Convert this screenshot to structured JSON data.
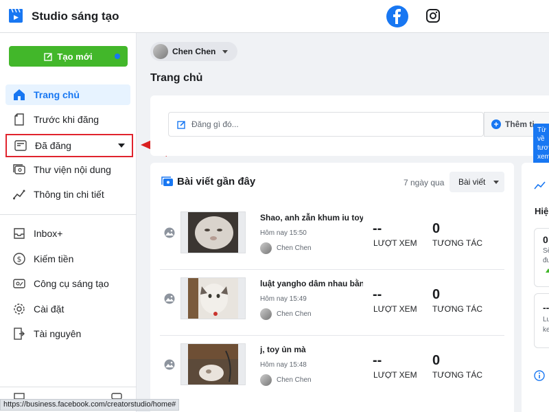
{
  "app": {
    "title": "Studio sáng tạo"
  },
  "header": {
    "facebook_icon": "facebook-icon",
    "instagram_icon": "instagram-icon"
  },
  "sidebar": {
    "create_label": "Tạo mới",
    "items": [
      {
        "label": "Trang chủ",
        "icon": "home-icon",
        "active": true
      },
      {
        "label": "Trước khi đăng",
        "icon": "draft-document-icon"
      },
      {
        "label": "Đã đăng",
        "icon": "published-posts-icon",
        "highlight": true
      },
      {
        "label": "Thư viện nội dung",
        "icon": "content-library-icon"
      },
      {
        "label": "Thông tin chi tiết",
        "icon": "insights-chart-icon"
      },
      {
        "label": "Inbox+",
        "icon": "inbox-icon"
      },
      {
        "label": "Kiếm tiền",
        "icon": "dollar-icon"
      },
      {
        "label": "Công cụ sáng tạo",
        "icon": "creative-tools-icon"
      },
      {
        "label": "Cài đặt",
        "icon": "gear-icon"
      },
      {
        "label": "Tài nguyên",
        "icon": "resources-icon"
      }
    ]
  },
  "main": {
    "page_switcher": "Chen Chen",
    "page_title": "Trang chủ",
    "compose": {
      "placeholder": "Đăng gì đó...",
      "add_label": "Thêm ti"
    },
    "recent_posts": {
      "title": "Bài viết gần đây",
      "range": "7 ngày qua",
      "filter": "Bài viết",
      "posts": [
        {
          "title": "Shao, anh zẫn khum iu toy ...",
          "time": "Hôm nay 15:50",
          "author": "Chen Chen",
          "views": "--",
          "views_label": "LƯỢT XEM",
          "engagement": "0",
          "engagement_label": "TƯƠNG TÁC"
        },
        {
          "title": "luật yangho dâm nhau bằn...",
          "time": "Hôm nay 15:49",
          "author": "Chen Chen",
          "views": "--",
          "views_label": "LƯỢT XEM",
          "engagement": "0",
          "engagement_label": "TƯƠNG TÁC"
        },
        {
          "title": "j, toy ủn mà",
          "time": "Hôm nay 15:48",
          "author": "Chen Chen",
          "views": "--",
          "views_label": "LƯỢT XEM",
          "engagement": "0",
          "engagement_label": "TƯƠNG TÁC"
        }
      ]
    },
    "right_panel": {
      "tooltip": [
        "Từ",
        "về",
        "tươ",
        "xem"
      ],
      "section": "Hiệ",
      "value1": "0",
      "sub1a": "Sẽ",
      "sub1b": "đư",
      "value2": "--",
      "sub2a": "Lư",
      "sub2b": "ke"
    }
  },
  "statusbar": {
    "url": "https://business.facebook.com/creatorstudio/home#"
  }
}
